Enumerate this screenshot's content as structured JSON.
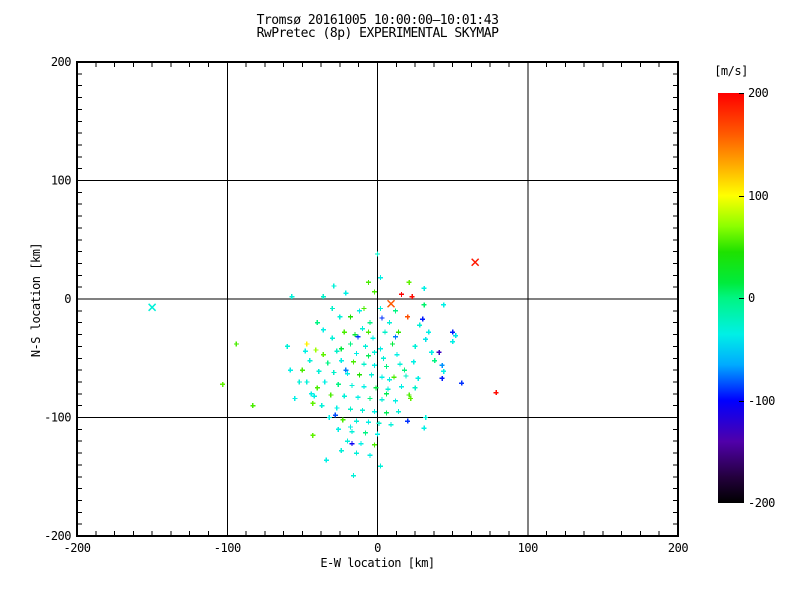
{
  "chart_data": {
    "type": "scatter",
    "title": "Tromsø 20161005 10:00:00–10:01:43",
    "subtitle": "RwPretec (8p) EXPERIMENTAL SKYMAP",
    "xlabel": "E-W location [km]",
    "ylabel": "N-S location [km]",
    "xlim": [
      -200,
      200
    ],
    "ylim": [
      -200,
      200
    ],
    "xticks": [
      -200,
      -100,
      0,
      100,
      200
    ],
    "yticks": [
      -200,
      -100,
      0,
      100,
      200
    ],
    "x_minor_step": 12.5,
    "y_minor_step": 10,
    "grid": true,
    "grid_values": [
      -100,
      0,
      100
    ],
    "axis_color": "#000000",
    "background_color": "#ffffff",
    "marker": "plus",
    "colorbar": {
      "label": "[m/s]",
      "ticks": [
        200,
        100,
        0,
        -100,
        -200
      ],
      "lim": [
        -200,
        200
      ]
    },
    "colormap_stops": [
      [
        -200,
        "#000000"
      ],
      [
        -175,
        "#23003c"
      ],
      [
        -140,
        "#5000aa"
      ],
      [
        -100,
        "#0000ff"
      ],
      [
        -65,
        "#00aaff"
      ],
      [
        -35,
        "#00f0e6"
      ],
      [
        0,
        "#00f582"
      ],
      [
        15,
        "#00eb3c"
      ],
      [
        45,
        "#1ee100"
      ],
      [
        70,
        "#8cff00"
      ],
      [
        100,
        "#ffff00"
      ],
      [
        130,
        "#ffaa00"
      ],
      [
        160,
        "#ff5a00"
      ],
      [
        200,
        "#ff0000"
      ]
    ],
    "points": [
      [
        -150,
        -7,
        -30,
        "x"
      ],
      [
        9,
        -4,
        160,
        "x"
      ],
      [
        65,
        31,
        190,
        "x"
      ],
      [
        16,
        4,
        200
      ],
      [
        23,
        2,
        195
      ],
      [
        79,
        -79,
        195
      ],
      [
        20,
        -15,
        165
      ],
      [
        -47,
        -38,
        105
      ],
      [
        -41,
        -43,
        75
      ],
      [
        50,
        -28,
        -95
      ],
      [
        43,
        -56,
        -70
      ],
      [
        41,
        -45,
        -130
      ],
      [
        43,
        -67,
        -95
      ],
      [
        30,
        -17,
        -95
      ],
      [
        20,
        -103,
        -90
      ],
      [
        -17,
        -122,
        -105
      ],
      [
        -13,
        -32,
        -90
      ],
      [
        -21,
        -60,
        -75
      ],
      [
        3,
        -16,
        -90
      ],
      [
        12,
        -32,
        -75
      ],
      [
        56,
        -71,
        -90
      ],
      [
        -28,
        -98,
        -85
      ],
      [
        -94,
        -38,
        55
      ],
      [
        -103,
        -72,
        60
      ],
      [
        -83,
        -90,
        55
      ],
      [
        -43,
        -115,
        60
      ],
      [
        21,
        -81,
        55
      ],
      [
        -40,
        -75,
        55
      ],
      [
        -43,
        -88,
        60
      ],
      [
        -6,
        14,
        55
      ],
      [
        21,
        14,
        60
      ],
      [
        -2,
        6,
        55
      ],
      [
        -9,
        -8,
        55
      ],
      [
        -22,
        -28,
        55
      ],
      [
        -36,
        -47,
        60
      ],
      [
        -16,
        -53,
        55
      ],
      [
        -50,
        -60,
        55
      ],
      [
        11,
        -66,
        55
      ],
      [
        -31,
        -81,
        55
      ],
      [
        22,
        -84,
        60
      ],
      [
        -23,
        -102,
        55
      ],
      [
        -2,
        -123,
        55
      ],
      [
        -6,
        -28,
        55
      ],
      [
        -12,
        -64,
        45
      ],
      [
        14,
        -28,
        50
      ],
      [
        -18,
        -15,
        45
      ],
      [
        0,
        38,
        -25
      ],
      [
        2,
        18,
        -35
      ],
      [
        -29,
        11,
        -30
      ],
      [
        -21,
        5,
        -35
      ],
      [
        -36,
        2,
        -25
      ],
      [
        -57,
        2,
        -30
      ],
      [
        31,
        9,
        -35
      ],
      [
        44,
        -5,
        -35
      ],
      [
        31,
        -5,
        5
      ],
      [
        2,
        -141,
        -30
      ],
      [
        -34,
        -136,
        -35
      ],
      [
        -24,
        -128,
        -30
      ],
      [
        -18,
        -108,
        -35
      ],
      [
        31,
        -109,
        -35
      ],
      [
        -16,
        -149,
        -30
      ],
      [
        50,
        -36,
        -35
      ],
      [
        52,
        -31,
        -40
      ],
      [
        32,
        -34,
        -40
      ],
      [
        27,
        -67,
        -35
      ],
      [
        44,
        -61,
        -35
      ],
      [
        32,
        -100,
        -30
      ],
      [
        6,
        -80,
        10
      ],
      [
        -55,
        -84,
        -35
      ],
      [
        -42,
        -82,
        -35
      ],
      [
        -5,
        -20,
        0
      ],
      [
        -10,
        -25,
        -30
      ],
      [
        -15,
        -30,
        20
      ],
      [
        -3,
        -33,
        -35
      ],
      [
        5,
        -28,
        -25
      ],
      [
        -30,
        -33,
        -30
      ],
      [
        -18,
        -38,
        0
      ],
      [
        -8,
        -40,
        -30
      ],
      [
        2,
        -42,
        -35
      ],
      [
        10,
        -38,
        15
      ],
      [
        -27,
        -44,
        -25
      ],
      [
        -14,
        -46,
        -35
      ],
      [
        -6,
        -48,
        10
      ],
      [
        4,
        -50,
        -30
      ],
      [
        13,
        -47,
        -35
      ],
      [
        -45,
        -52,
        -30
      ],
      [
        -33,
        -54,
        0
      ],
      [
        -24,
        -52,
        -35
      ],
      [
        -9,
        -55,
        -25
      ],
      [
        -2,
        -56,
        -35
      ],
      [
        6,
        -57,
        0
      ],
      [
        15,
        -55,
        -30
      ],
      [
        24,
        -53,
        -35
      ],
      [
        -39,
        -61,
        -30
      ],
      [
        -29,
        -62,
        -25
      ],
      [
        -20,
        -63,
        -35
      ],
      [
        -4,
        -64,
        -30
      ],
      [
        3,
        -66,
        -35
      ],
      [
        19,
        -65,
        -25
      ],
      [
        -47,
        -70,
        -30
      ],
      [
        -35,
        -70,
        -35
      ],
      [
        -26,
        -72,
        0
      ],
      [
        -17,
        -73,
        -30
      ],
      [
        -9,
        -74,
        -35
      ],
      [
        -1,
        -75,
        15
      ],
      [
        7,
        -76,
        -30
      ],
      [
        16,
        -74,
        -35
      ],
      [
        25,
        -75,
        -25
      ],
      [
        -44,
        -80,
        -35
      ],
      [
        -22,
        -82,
        -30
      ],
      [
        -13,
        -83,
        -35
      ],
      [
        -5,
        -84,
        0
      ],
      [
        3,
        -85,
        -30
      ],
      [
        12,
        -86,
        -35
      ],
      [
        -37,
        -90,
        -30
      ],
      [
        -27,
        -92,
        -35
      ],
      [
        -18,
        -93,
        -25
      ],
      [
        -10,
        -94,
        -30
      ],
      [
        -2,
        -95,
        -35
      ],
      [
        6,
        -96,
        10
      ],
      [
        14,
        -95,
        -30
      ],
      [
        -32,
        -100,
        -35
      ],
      [
        -14,
        -103,
        -30
      ],
      [
        -6,
        -104,
        -35
      ],
      [
        1,
        -105,
        -25
      ],
      [
        9,
        -106,
        -30
      ],
      [
        -26,
        -110,
        -35
      ],
      [
        -17,
        -112,
        -30
      ],
      [
        -8,
        -113,
        0
      ],
      [
        0,
        -114,
        -35
      ],
      [
        -20,
        -120,
        -30
      ],
      [
        -11,
        -122,
        -35
      ],
      [
        -14,
        -130,
        -30
      ],
      [
        -5,
        -132,
        -35
      ],
      [
        -25,
        -15,
        -30
      ],
      [
        -40,
        -20,
        0
      ],
      [
        -48,
        -44,
        -35
      ],
      [
        8,
        -20,
        -30
      ],
      [
        -52,
        -70,
        -30
      ],
      [
        -58,
        -60,
        -35
      ],
      [
        36,
        -45,
        -35
      ],
      [
        38,
        -52,
        0
      ],
      [
        -12,
        -10,
        -35
      ],
      [
        2,
        -8,
        -30
      ],
      [
        -30,
        -8,
        -25
      ],
      [
        12,
        -10,
        0
      ],
      [
        -60,
        -40,
        -30
      ],
      [
        -36,
        -26,
        -35
      ],
      [
        25,
        -40,
        -30
      ],
      [
        18,
        -60,
        0
      ],
      [
        -2,
        -45,
        -30
      ],
      [
        8,
        -68,
        -35
      ],
      [
        -24,
        -42,
        15
      ],
      [
        34,
        -28,
        -35
      ],
      [
        28,
        -22,
        -30
      ]
    ]
  }
}
